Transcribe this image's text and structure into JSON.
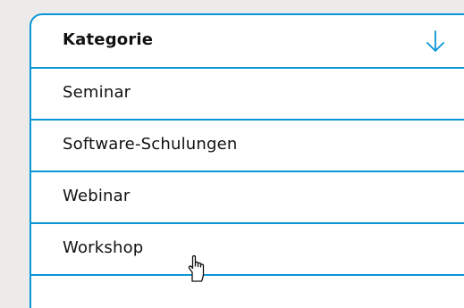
{
  "dropdown": {
    "header": {
      "label": "Kategorie",
      "icon": "arrow-down-icon"
    },
    "options": [
      {
        "label": "Seminar"
      },
      {
        "label": "Software-Schulungen"
      },
      {
        "label": "Webinar"
      },
      {
        "label": "Workshop"
      }
    ]
  },
  "cursor": {
    "icon": "hand-pointer-icon",
    "hovered_option": "Workshop"
  },
  "colors": {
    "accent": "#0a96d6",
    "background": "#ecebe9",
    "panel": "#ffffff",
    "text": "#111111"
  }
}
